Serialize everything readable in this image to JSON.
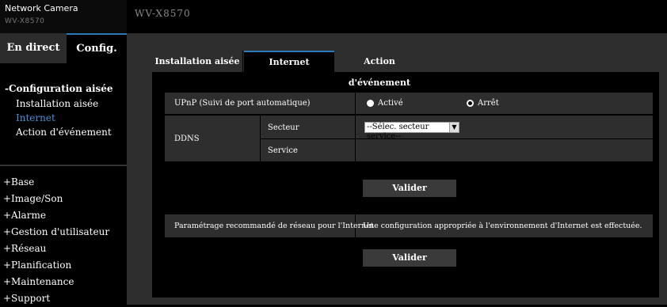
{
  "header": {
    "brand_title": "Network Camera",
    "brand_model_small": "WV-X8570",
    "model_title": "WV-X8570"
  },
  "left_tabs": {
    "live": "En direct",
    "config": "Config."
  },
  "nav": {
    "section_title": "-Configuration aisée",
    "items": [
      "Installation aisée",
      "Internet",
      "Action d'événement"
    ],
    "active_item": "Internet"
  },
  "groups": [
    "+Base",
    "+Image/Son",
    "+Alarme",
    "+Gestion d'utilisateur",
    "+Réseau",
    "+Planification",
    "+Maintenance",
    "+Support"
  ],
  "subtabs": [
    "Installation aisée",
    "Internet",
    "Action d'événement"
  ],
  "form": {
    "upnp_label": "UPnP (Suivi de port automatique)",
    "upnp_on": "Activé",
    "upnp_off": "Arrêt",
    "upnp_selected": "Arrêt",
    "ddns_label": "DDNS",
    "sector_label": "Secteur",
    "sector_value": "--Sélec. secteur service--",
    "service_label": "Service",
    "submit1": "Valider",
    "recommended_label": "Paramétrage recommandé de réseau pour l'Internet",
    "recommended_text": "Une configuration appropriée à l'environnement d'Internet est effectuée.",
    "submit2": "Valider"
  },
  "colors": {
    "accent": "#2b7bb9",
    "active_link": "#4a90d9",
    "panel_bg": "#2e2e2e"
  }
}
